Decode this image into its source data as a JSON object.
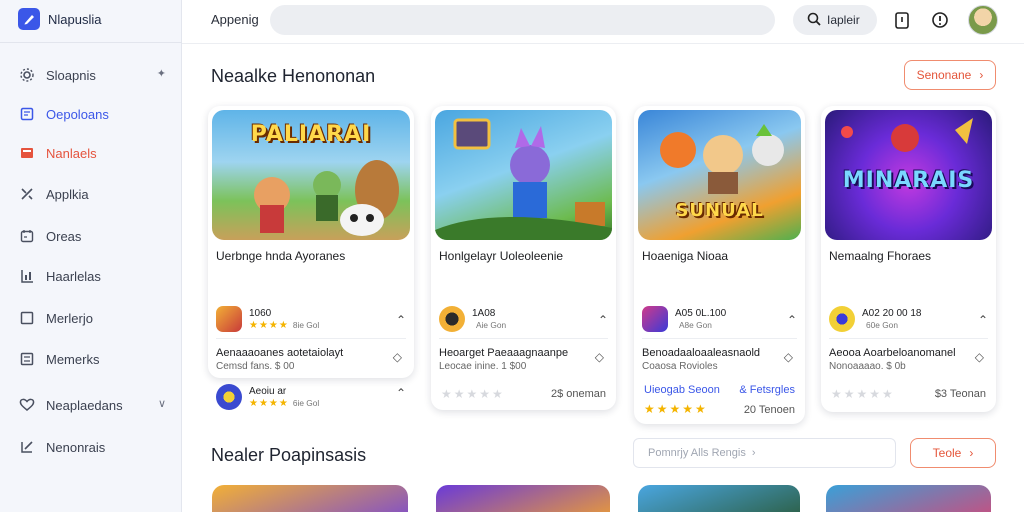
{
  "app": {
    "name": "Nlapuslia"
  },
  "sidebar": {
    "items": [
      {
        "label": "Sloapnis",
        "icon": "gear-icon",
        "trail": "✦"
      },
      {
        "label": "Oepoloans",
        "icon": "document-icon"
      },
      {
        "label": "Nanlaels",
        "icon": "folder-icon"
      },
      {
        "label": "Applkia",
        "icon": "tools-icon"
      },
      {
        "label": "Oreas",
        "icon": "calendar-icon"
      },
      {
        "label": "Haarlelas",
        "icon": "chart-icon"
      },
      {
        "label": "Merlerjo",
        "icon": "square-icon"
      },
      {
        "label": "Memerks",
        "icon": "list-icon"
      },
      {
        "label": "Neaplaedans",
        "icon": "heart-icon",
        "trail": "∨"
      },
      {
        "label": "Nenonrais",
        "icon": "edit-icon"
      }
    ]
  },
  "topbar": {
    "label": "Appenig",
    "search_placeholder": "",
    "search_button": "Iapleir",
    "icons": [
      "clipboard-icon",
      "info-icon"
    ]
  },
  "section1": {
    "title": "Neaalke Henononan",
    "button": "Senonane"
  },
  "cards": [
    {
      "art_title": "PALIARAI",
      "art_colors": [
        "#5fb4e8",
        "#7cc25a",
        "#c8a05a"
      ],
      "title": "Uerbnge hnda Ayoranes",
      "row1": {
        "text": "1060",
        "stars": "★★★★",
        "meta": "8ie Gol"
      },
      "desc": "Aenaaaoanes aotetaiolayt",
      "desc_sub": "Cemsd fans. $ 00",
      "row2": {
        "text": "Aeoiu ar",
        "stars": "★★★★",
        "meta": "6ie Gol"
      },
      "footer": null
    },
    {
      "art_title": "",
      "art_colors": [
        "#4aa6e0",
        "#6dbb4f",
        "#8a6ad8"
      ],
      "title": "Honlgelayr Uoleoleenie",
      "row1": {
        "text": "1A08",
        "stars": "",
        "meta": "Aie Gon"
      },
      "desc": "Heoarget Paeaaagnaanpe",
      "desc_sub": "Leocae inine. 1 $00",
      "row2": null,
      "footer": {
        "stars": "★★★★★",
        "price": "2$ oneman",
        "gold": false
      }
    },
    {
      "art_title": "SUNUAL",
      "art_colors": [
        "#3a86d8",
        "#f0a030",
        "#4fb04f"
      ],
      "title": "Hoaeniga Nioaa",
      "row1": {
        "text": "A05 0L.100",
        "stars": "",
        "meta": "A8e Gon"
      },
      "desc": "Benoadaaloaaleasnaold",
      "desc_sub": "Coaosa Rovioles",
      "row2": null,
      "footer": {
        "link_left": "Uieogab Seoon",
        "link_right": "& Fetsrgles",
        "stars": "★★★★★",
        "price": "20 Tenoen",
        "gold": true
      }
    },
    {
      "art_title": "MINARAIS",
      "art_colors": [
        "#6a2bd8",
        "#c23ae0",
        "#2a1a7a"
      ],
      "title": "Nemaalng Fhoraes",
      "row1": {
        "text": "A02 20 00 18",
        "stars": "",
        "meta": "60e Gon"
      },
      "desc": "Aeooa Aoarbeloanomanel",
      "desc_sub": "Nonoaaaao. $ 0b",
      "row2": null,
      "footer": {
        "stars": "★★★★★",
        "price": "$3 Teonan",
        "gold": false
      }
    }
  ],
  "section2": {
    "title": "Nealer Poapinsasis",
    "filter_placeholder": "Pomnrjy Alls Rengis",
    "button": "Teole"
  },
  "thumbs": [
    {
      "colors": [
        "#f2b036",
        "#7a4ad0"
      ]
    },
    {
      "colors": [
        "#6a3ad8",
        "#f0a030"
      ]
    },
    {
      "colors": [
        "#4aa6e0",
        "#2a5a3a"
      ]
    },
    {
      "colors": [
        "#3aa0d8",
        "#d04a7a"
      ]
    }
  ]
}
